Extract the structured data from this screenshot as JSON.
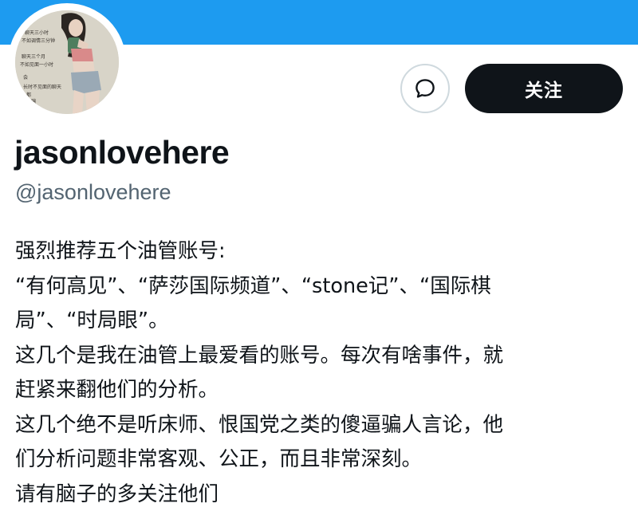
{
  "profile": {
    "display_name": "jasonlovehere",
    "handle": "@jasonlovehere",
    "avatar": {
      "text_lines": [
        "聊天三小时",
        "不如调情三分钟",
        "聊天三个月",
        "不如见面一小时",
        "会",
        "长时不见面的聊天",
        "都",
        "骗"
      ]
    }
  },
  "actions": {
    "message_icon": "chat-bubble-icon",
    "follow_label": "关注"
  },
  "bio": {
    "lines": [
      "强烈推荐五个油管账号:",
      "“有何高见”、“萨莎国际频道”、“stone记”、“国际棋",
      "局”、“时局眼”。",
      "这几个是我在油管上最爱看的账号。每次有啥事件，就",
      "赶紧来翻他们的分析。",
      "这几个绝不是听床师、恨国党之类的傻逼骗人言论，他",
      "们分析问题非常客观、公正，而且非常深刻。",
      "请有脑子的多关注他们"
    ]
  },
  "colors": {
    "banner": "#1d9bf0",
    "follow_button": "#0f1419",
    "handle": "#536471",
    "text": "#0f1419"
  }
}
